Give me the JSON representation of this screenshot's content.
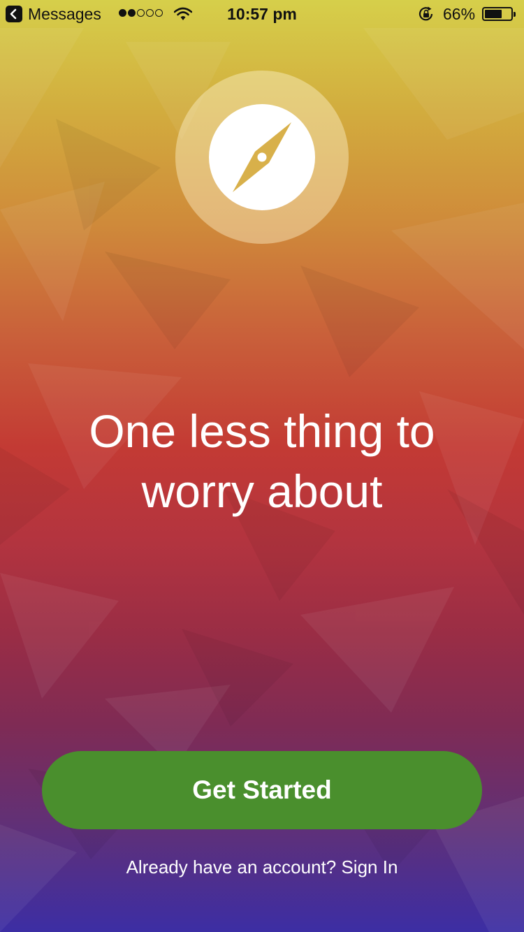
{
  "status_bar": {
    "back_label": "Messages",
    "time": "10:57 pm",
    "battery_percent": "66%",
    "battery_level": 0.66,
    "signal_bars_filled": 2,
    "signal_bars_total": 5,
    "icons": [
      "back-chevron-icon",
      "signal-dots-icon",
      "wifi-icon",
      "orientation-lock-icon",
      "battery-icon"
    ]
  },
  "logo": {
    "icon": "compass-icon",
    "accent_color": "#d8b04a"
  },
  "headline": {
    "line1": "One less thing to",
    "line2": "worry about"
  },
  "cta": {
    "label": "Get Started",
    "color": "#4a8f2d"
  },
  "signin": {
    "prompt": "Already have an account?",
    "link_label": "Sign In"
  },
  "colors": {
    "gradient_top": "#d6cf4a",
    "gradient_middle": "#c33a34",
    "gradient_bottom": "#3c2ea4"
  }
}
